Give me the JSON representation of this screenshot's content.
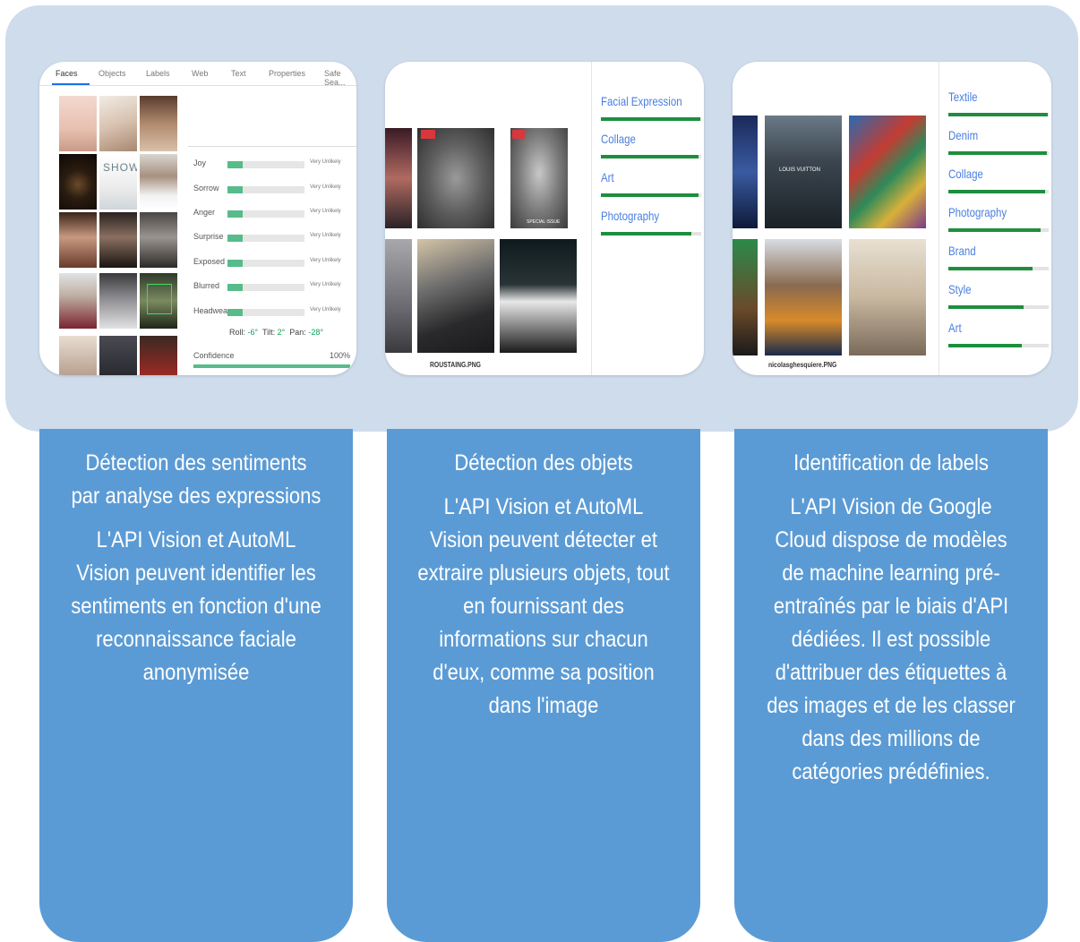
{
  "panels": [
    {
      "title": "Détection des sentiments par analyse des expressions",
      "body": "L'API Vision et AutoML Vision peuvent identifier les sentiments en fonction d'une reconnaissance faciale anonymisée"
    },
    {
      "title": "Détection des objets",
      "body": "L'API Vision et AutoML Vision peuvent détecter et extraire plusieurs objets, tout en fournissant des informations sur chacun d'eux, comme sa position dans l'image"
    },
    {
      "title": "Identification de labels",
      "body": "L'API Vision de Google Cloud dispose de modèles de machine learning pré-entraînés par le biais d'API dédiées. Il est possible d'attribuer des étiquettes à des images et de les classer dans des millions de catégories prédéfinies."
    }
  ],
  "faces_screenshot": {
    "tabs": [
      "Faces",
      "Objects",
      "Labels",
      "Web",
      "Text",
      "Properties",
      "Safe Sea..."
    ],
    "active_tab": "Faces",
    "thumb_text": "SHOW",
    "emotions": [
      {
        "label": "Joy",
        "likelihood": "Very Unlikely"
      },
      {
        "label": "Sorrow",
        "likelihood": "Very Unlikely"
      },
      {
        "label": "Anger",
        "likelihood": "Very Unlikely"
      },
      {
        "label": "Surprise",
        "likelihood": "Very Unlikely"
      },
      {
        "label": "Exposed",
        "likelihood": "Very Unlikely"
      },
      {
        "label": "Blurred",
        "likelihood": "Very Unlikely"
      },
      {
        "label": "Headwear",
        "likelihood": "Very Unlikely"
      }
    ],
    "angles": {
      "roll_label": "Roll:",
      "roll": "-6°",
      "tilt_label": "Tilt:",
      "tilt": "2°",
      "pan_label": "Pan:",
      "pan": "-28°"
    },
    "confidence_label": "Confidence",
    "confidence_value": "100%",
    "confidence_fraction": 1.0
  },
  "objects_screenshot": {
    "filename": "ROUSTAING.PNG",
    "overlay_text": "SPECIAL ISSUE",
    "labels": [
      {
        "name": "Facial Expression",
        "score": 0.99
      },
      {
        "name": "Collage",
        "score": 0.97
      },
      {
        "name": "Art",
        "score": 0.97
      },
      {
        "name": "Photography",
        "score": 0.9
      }
    ]
  },
  "labels_screenshot": {
    "filename": "nicolasghesquiere.PNG",
    "overlay_text": "LOUIS VUITTON",
    "labels": [
      {
        "name": "Textile",
        "score": 0.99
      },
      {
        "name": "Denim",
        "score": 0.98
      },
      {
        "name": "Collage",
        "score": 0.96
      },
      {
        "name": "Photography",
        "score": 0.92
      },
      {
        "name": "Brand",
        "score": 0.84
      },
      {
        "name": "Style",
        "score": 0.75
      },
      {
        "name": "Art",
        "score": 0.73
      }
    ]
  },
  "colors": {
    "band": "#cfdcec",
    "card": "#5b9bd5",
    "label_text": "#4a7fe0",
    "label_bar": "#1e8e3e",
    "emotion_bar": "#57bb8a"
  }
}
